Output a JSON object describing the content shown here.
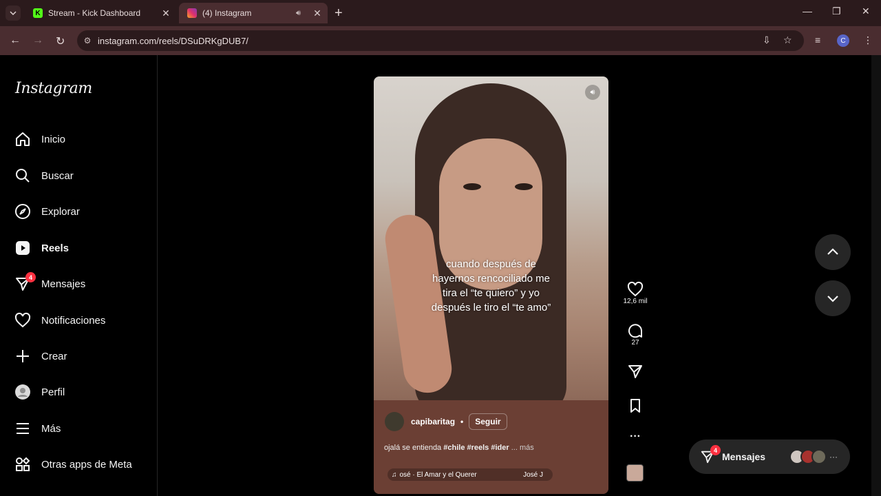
{
  "browser": {
    "tabs": [
      {
        "title": "Stream - Kick Dashboard",
        "favicon": "kick-logo-icon",
        "color": "#53fc18"
      },
      {
        "title": "(4) Instagram",
        "favicon": "instagram-logo-icon",
        "active": true
      }
    ],
    "url": "instagram.com/reels/DSuDRKgDUB7/",
    "profile_initial": "C"
  },
  "sidebar": {
    "logo": "Instagram",
    "items": [
      {
        "label": "Inicio",
        "icon": "home-icon"
      },
      {
        "label": "Buscar",
        "icon": "search-icon"
      },
      {
        "label": "Explorar",
        "icon": "compass-icon"
      },
      {
        "label": "Reels",
        "icon": "reels-icon",
        "active": true
      },
      {
        "label": "Mensajes",
        "icon": "messenger-icon",
        "badge": "4"
      },
      {
        "label": "Notificaciones",
        "icon": "heart-icon"
      },
      {
        "label": "Crear",
        "icon": "plus-icon"
      },
      {
        "label": "Perfil",
        "icon": "profile-avatar-icon"
      },
      {
        "label": "Más",
        "icon": "menu-icon"
      },
      {
        "label": "Otras apps de Meta",
        "icon": "meta-apps-icon"
      }
    ]
  },
  "reel": {
    "overlay_lines": [
      "cuando después de",
      "hayernos rencociliado me",
      "tira el “te quiero” y yo",
      "después le tiro el “te amo”"
    ],
    "author": "capibaritag",
    "separator": "•",
    "follow_label": "Seguir",
    "caption": "ojalá se entienda",
    "hashtags": "#chile #reels #ider",
    "more": "... más",
    "audio": "osé · El Amar y el Querer",
    "audio_artist": "José J"
  },
  "actions": {
    "likes": "12,6 mil",
    "comments": "27"
  },
  "messages_pill": {
    "label": "Mensajes",
    "badge": "4"
  },
  "colors": {
    "badge": "#ff3040",
    "tab_bg": "#2b1a1c",
    "toolbar_bg": "#4a2d30"
  }
}
